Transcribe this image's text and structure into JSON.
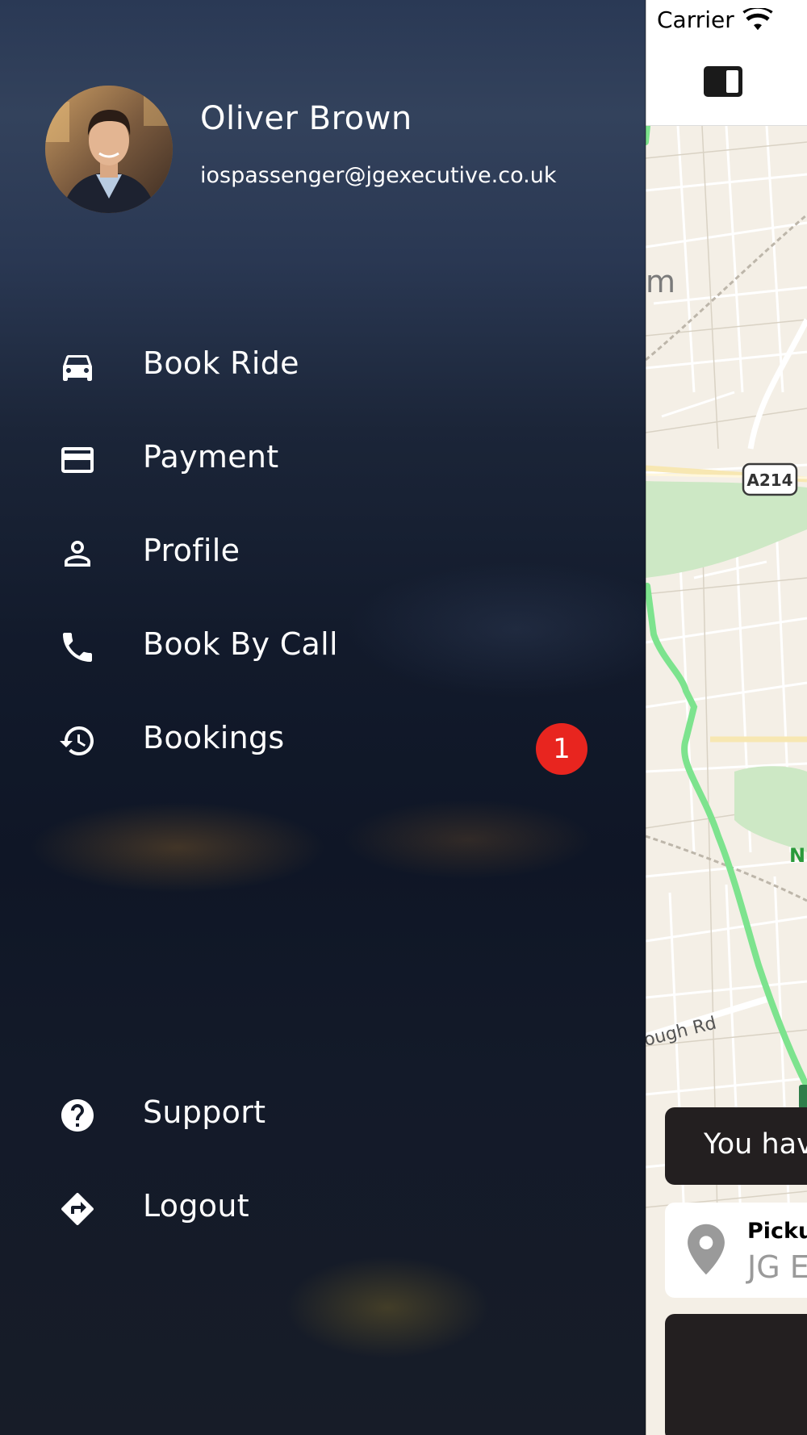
{
  "drawer": {
    "user": {
      "name": "Oliver Brown",
      "email": "iospassenger@jgexecutive.co.uk"
    },
    "items": [
      {
        "label": "Book Ride",
        "icon": "car-icon"
      },
      {
        "label": "Payment",
        "icon": "credit-card-icon"
      },
      {
        "label": "Profile",
        "icon": "person-icon"
      },
      {
        "label": "Book By Call",
        "icon": "phone-icon"
      },
      {
        "label": "Bookings",
        "icon": "history-icon",
        "badge": "1"
      }
    ],
    "bottom_items": [
      {
        "label": "Support",
        "icon": "help-circle-icon"
      },
      {
        "label": "Logout",
        "icon": "directions-icon"
      }
    ],
    "badge_color": "#e8251f"
  },
  "status_bar": {
    "carrier": "Carrier",
    "wifi_icon": "wifi-icon"
  },
  "map": {
    "road_label": "A214",
    "place_fragment": "m",
    "street_fragment": "ough Rd",
    "park_fragment": "N"
  },
  "notice": {
    "text": "You hav"
  },
  "pickup": {
    "title": "Pickup",
    "value": "JG E",
    "icon": "location-pin-icon"
  },
  "colors": {
    "card_dark": "#231f20",
    "map_background": "#f4efe6",
    "park_green": "#cde8c5",
    "route_green": "#7de38e"
  }
}
